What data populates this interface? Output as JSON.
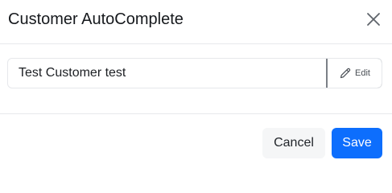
{
  "dialog": {
    "title": "Customer AutoComplete",
    "close_icon": "close-icon"
  },
  "customer": {
    "value": "Test Customer test",
    "edit_label": "Edit",
    "edit_icon": "pencil-icon"
  },
  "footer": {
    "cancel_label": "Cancel",
    "save_label": "Save"
  },
  "colors": {
    "primary": "#0d6efd",
    "cancel_bg": "#f5f6f7",
    "divider": "#e7e9ec"
  }
}
